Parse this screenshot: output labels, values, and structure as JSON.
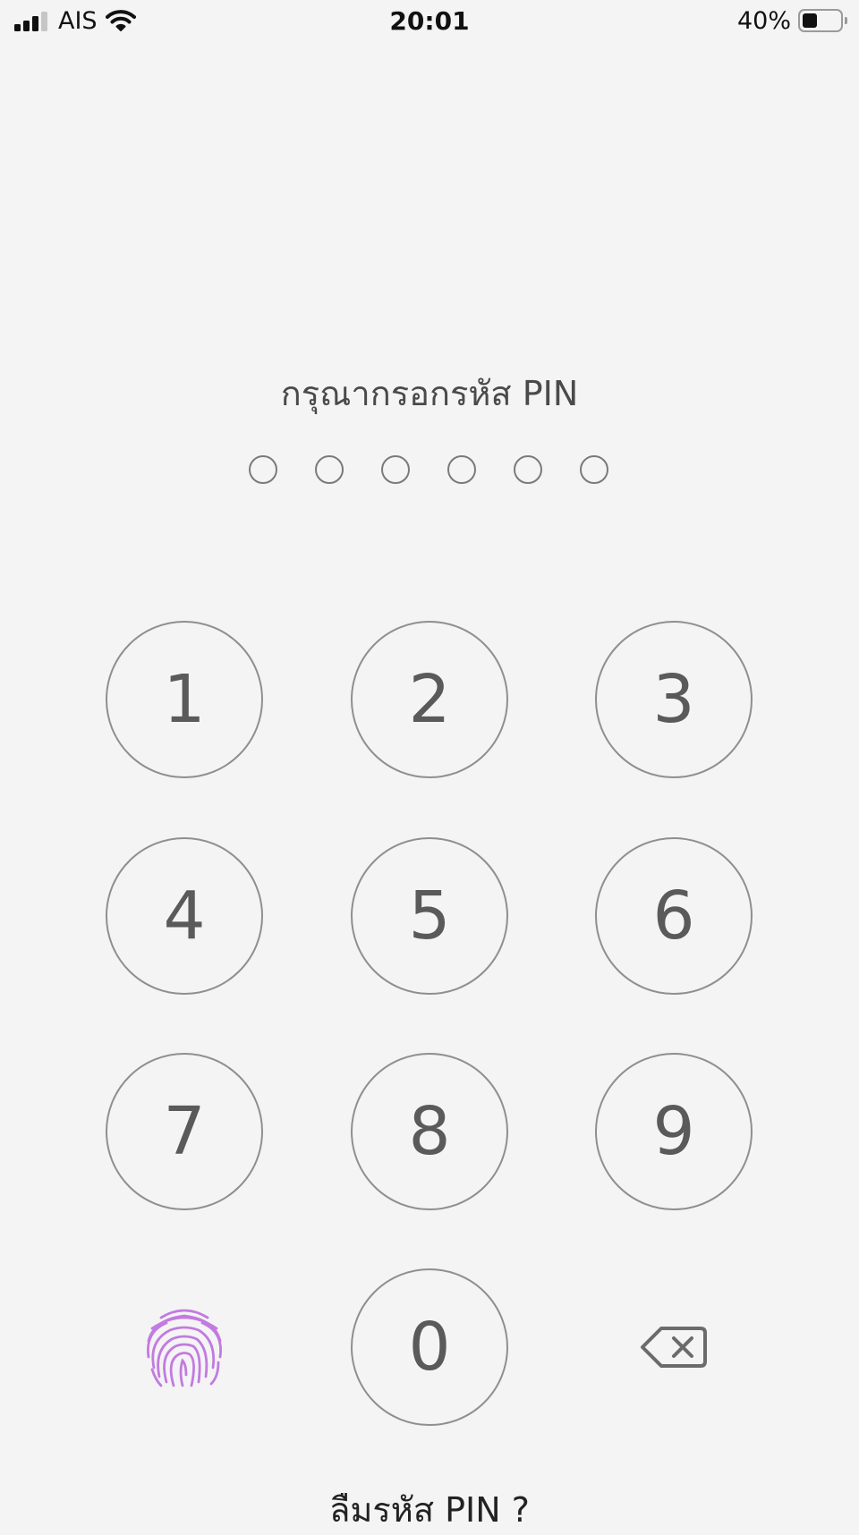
{
  "status_bar": {
    "carrier": "AIS",
    "time": "20:01",
    "battery_percent_label": "40%",
    "battery_level": 0.4,
    "signal_bars_filled": 3,
    "signal_bars_total": 4,
    "wifi_icon": "wifi-icon"
  },
  "pin": {
    "prompt": "กรุณากรอกรหัส PIN",
    "length": 6,
    "entered": 0
  },
  "keypad": {
    "keys": [
      "1",
      "2",
      "3",
      "4",
      "5",
      "6",
      "7",
      "8",
      "9",
      "0"
    ],
    "biometric_icon": "fingerprint-icon",
    "delete_icon": "backspace-icon"
  },
  "forgot_pin_label": "ลืมรหัส PIN ?",
  "colors": {
    "background": "#f4f4f4",
    "key_border": "#8f8f8f",
    "key_text": "#5a5a5a",
    "fingerprint": "#c27be0",
    "delete_icon": "#6b6b6b"
  }
}
